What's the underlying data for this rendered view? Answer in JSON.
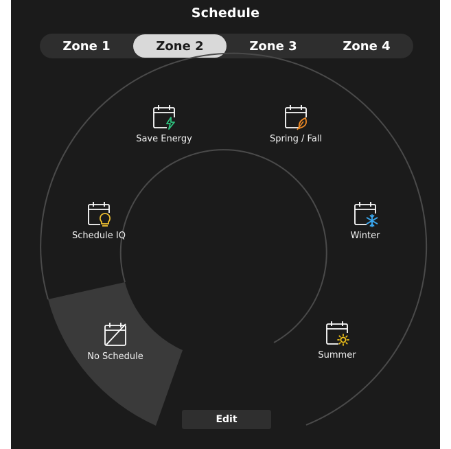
{
  "header": {
    "title": "Schedule"
  },
  "zones": [
    {
      "label": "Zone 1",
      "active": false
    },
    {
      "label": "Zone 2",
      "active": true
    },
    {
      "label": "Zone 3",
      "active": false
    },
    {
      "label": "Zone 4",
      "active": false
    }
  ],
  "presets": {
    "save_energy": {
      "label": "Save Energy",
      "icon": "calendar-bolt-icon",
      "accent": "#2ec27e"
    },
    "spring_fall": {
      "label": "Spring / Fall",
      "icon": "calendar-leaf-icon",
      "accent": "#f08a24"
    },
    "schedule_iq": {
      "label": "Schedule IQ",
      "icon": "calendar-lightbulb-icon",
      "accent": "#f2c230"
    },
    "winter": {
      "label": "Winter",
      "icon": "calendar-snowflake-icon",
      "accent": "#3aa8f0"
    },
    "no_schedule": {
      "label": "No Schedule",
      "icon": "calendar-off-icon",
      "accent": "#ffffff",
      "selected": true
    },
    "summer": {
      "label": "Summer",
      "icon": "calendar-sun-icon",
      "accent": "#f5c518"
    }
  },
  "edit": {
    "label": "Edit"
  },
  "colors": {
    "background": "#1b1b1b",
    "ring": "#4a4a4a",
    "selected_sector": "#3a3a3a",
    "active_tab": "#d9d9d9"
  }
}
